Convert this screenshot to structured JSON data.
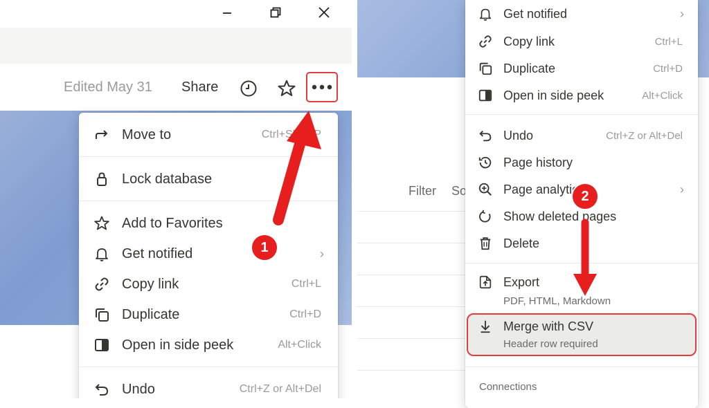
{
  "left": {
    "header": {
      "edited": "Edited May 31",
      "share": "Share"
    },
    "menu": {
      "items": [
        {
          "label": "Move to",
          "shortcut": "Ctrl+Shift+P",
          "icon": "arrow-turn-right-icon"
        },
        {
          "label": "Lock database",
          "icon": "lock-icon"
        },
        {
          "label": "Add to Favorites",
          "icon": "star-icon"
        },
        {
          "label": "Get notified",
          "icon": "bell-icon"
        },
        {
          "label": "Copy link",
          "shortcut": "Ctrl+L",
          "icon": "link-icon"
        },
        {
          "label": "Duplicate",
          "shortcut": "Ctrl+D",
          "icon": "duplicate-icon"
        },
        {
          "label": "Open in side peek",
          "shortcut": "Alt+Click",
          "icon": "side-peek-icon"
        },
        {
          "label": "Undo",
          "shortcut": "Ctrl+Z or Alt+Del",
          "icon": "undo-icon"
        }
      ]
    },
    "badge": "1"
  },
  "right": {
    "view": {
      "filter": "Filter",
      "sort_partial": "So"
    },
    "menu": {
      "items": [
        {
          "label": "Get notified",
          "icon": "bell-icon"
        },
        {
          "label": "Copy link",
          "shortcut": "Ctrl+L",
          "icon": "link-icon"
        },
        {
          "label": "Duplicate",
          "shortcut": "Ctrl+D",
          "icon": "duplicate-icon"
        },
        {
          "label": "Open in side peek",
          "shortcut": "Alt+Click",
          "icon": "side-peek-icon"
        },
        {
          "label": "Undo",
          "shortcut": "Ctrl+Z or Alt+Del",
          "icon": "undo-icon"
        },
        {
          "label": "Page history",
          "icon": "history-icon"
        },
        {
          "label": "Page analytics",
          "icon": "analytics-icon"
        },
        {
          "label": "Show deleted pages",
          "icon": "restore-icon"
        },
        {
          "label": "Delete",
          "icon": "trash-icon"
        },
        {
          "label": "Export",
          "sublabel": "PDF, HTML, Markdown",
          "icon": "export-icon"
        },
        {
          "label": "Merge with CSV",
          "sublabel": "Header row required",
          "icon": "download-arrow-icon"
        }
      ],
      "connections": "Connections"
    },
    "badge": "2"
  },
  "colors": {
    "accent_red": "#e61e1e",
    "highlight_border": "#e03e3e",
    "cover_blue": "#8aa6d6"
  }
}
